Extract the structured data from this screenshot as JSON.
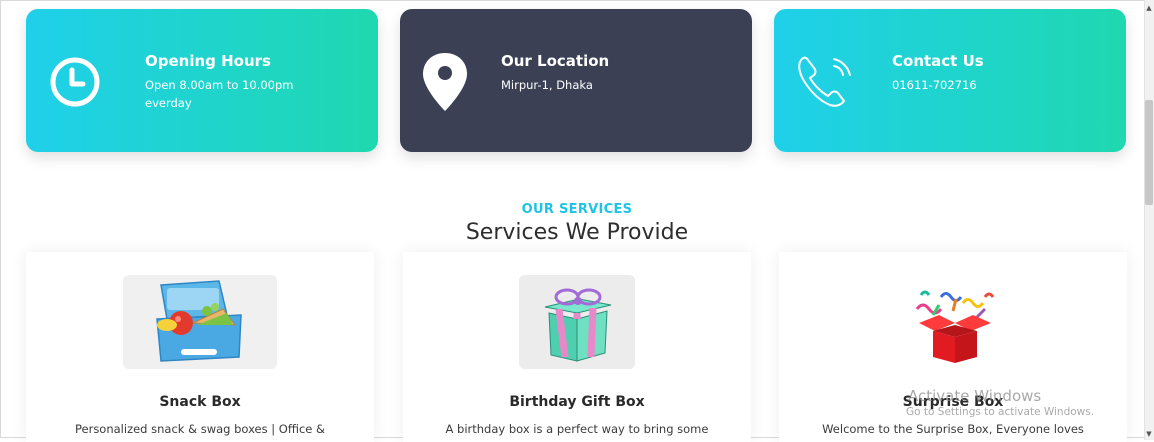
{
  "info_cards": {
    "hours": {
      "title": "Opening Hours",
      "line1": "Open 8.00am to 10.00pm",
      "line2": "everday",
      "icon": "clock-icon"
    },
    "location": {
      "title": "Our Location",
      "line1": "Mirpur-1, Dhaka",
      "icon": "map-pin-icon"
    },
    "contact": {
      "title": "Contact Us",
      "line1": "01611-702716",
      "icon": "phone-icon"
    }
  },
  "services": {
    "kicker": "OUR SERVICES",
    "title": "Services We Provide",
    "items": [
      {
        "name": "Snack Box",
        "desc": "Personalized snack & swag boxes | Office &",
        "image": "lunchbox-image"
      },
      {
        "name": "Birthday Gift Box",
        "desc": "A birthday box is a perfect way to bring some",
        "image": "gift-box-image"
      },
      {
        "name": "Surprise Box",
        "desc": "Welcome to the Surprise Box, Everyone loves",
        "image": "surprise-box-image"
      }
    ]
  },
  "watermark": {
    "title": "Activate Windows",
    "sub": "Go to Settings to activate Windows."
  },
  "colors": {
    "accent": "#1cc4e8",
    "teal": "#1fd8b0",
    "dark_card": "#3b4055"
  }
}
